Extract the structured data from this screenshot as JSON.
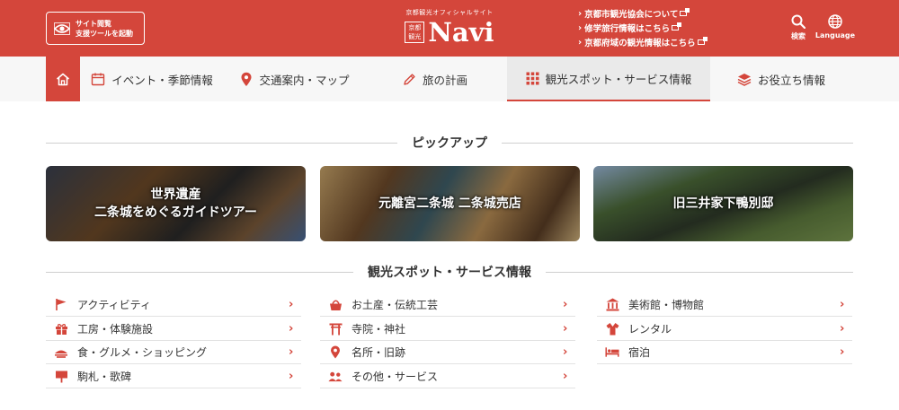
{
  "header": {
    "support_line1": "サイト閲覧",
    "support_line2": "支援ツールを起動",
    "logo_sub": "京都観光オフィシャルサイト",
    "logo_box_top": "京都",
    "logo_box_bottom": "観光",
    "logo_main": "Navi",
    "links": [
      "京都市観光協会について",
      "修学旅行情報はこちら",
      "京都府域の観光情報はこちら"
    ],
    "search_label": "検索",
    "language_label": "Language"
  },
  "nav": {
    "items": [
      {
        "label": "イベント・季節情報",
        "icon": "calendar-icon"
      },
      {
        "label": "交通案内・マップ",
        "icon": "map-pin-icon"
      },
      {
        "label": "旅の計画",
        "icon": "pencil-icon"
      },
      {
        "label": "観光スポット・サービス情報",
        "icon": "grid-icon"
      },
      {
        "label": "お役立ち情報",
        "icon": "layers-icon"
      }
    ]
  },
  "pickup": {
    "title": "ピックアップ",
    "cards": [
      {
        "line1": "世界遺産",
        "line2": "二条城をめぐるガイドツアー"
      },
      {
        "line1": "元離宮二条城 二条城売店",
        "line2": ""
      },
      {
        "line1": "旧三井家下鴨別邸",
        "line2": ""
      }
    ]
  },
  "services": {
    "title": "観光スポット・サービス情報",
    "col1": [
      {
        "label": "アクティビティ",
        "icon": "flag-icon"
      },
      {
        "label": "工房・体験施設",
        "icon": "gift-icon"
      },
      {
        "label": "食・グルメ・ショッピング",
        "icon": "food-icon"
      },
      {
        "label": "駒札・歌碑",
        "icon": "signboard-icon"
      }
    ],
    "col2": [
      {
        "label": "お土産・伝統工芸",
        "icon": "basket-icon"
      },
      {
        "label": "寺院・神社",
        "icon": "torii-icon"
      },
      {
        "label": "名所・旧跡",
        "icon": "location-icon"
      },
      {
        "label": "その他・サービス",
        "icon": "people-icon"
      }
    ],
    "col3": [
      {
        "label": "美術館・博物館",
        "icon": "museum-icon"
      },
      {
        "label": "レンタル",
        "icon": "kimono-icon"
      },
      {
        "label": "宿泊",
        "icon": "bed-icon"
      }
    ]
  },
  "colors": {
    "accent": "#d4463b"
  }
}
